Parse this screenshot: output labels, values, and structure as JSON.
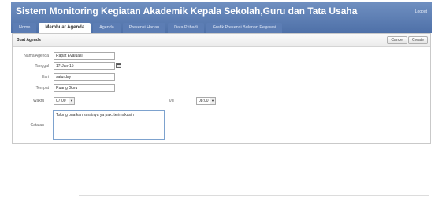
{
  "header": {
    "title": "Sistem Monitoring Kegiatan Akademik Kepala Sekolah,Guru dan Tata Usaha",
    "logout_label": "Logout"
  },
  "tabs": [
    {
      "label": "Home"
    },
    {
      "label": "Membuat Agenda",
      "active": true
    },
    {
      "label": "Agenda"
    },
    {
      "label": "Presensi Harian"
    },
    {
      "label": "Data Pribadi"
    },
    {
      "label": "Grafik Presensi Bulanan Pegawai"
    }
  ],
  "panel": {
    "title": "Buat Agenda",
    "cancel_label": "Cancel",
    "create_label": "Create"
  },
  "form": {
    "nama_agenda": {
      "label": "Nama Agenda",
      "value": "Rapat Evaluasi"
    },
    "tanggal": {
      "label": "Tanggal",
      "value": "17-Jan-15"
    },
    "hari": {
      "label": "Hari",
      "value": "saturday"
    },
    "tempat": {
      "label": "Tempat",
      "value": "Ruang Guru"
    },
    "waktu": {
      "label": "Waktu",
      "value": "07:00"
    },
    "sd": {
      "label": "s/d",
      "value": "08:00"
    },
    "catatan": {
      "label": "Catatan",
      "value": "Tolong buatkan suratnya ya pak. terimakasih"
    }
  },
  "icons": {
    "calendar": "calendar-icon",
    "dropdown": "chevron-down-icon"
  },
  "colors": {
    "header": "#5878b0",
    "tab_inactive": "#5c7db4",
    "textarea_border": "#7da2ce"
  }
}
